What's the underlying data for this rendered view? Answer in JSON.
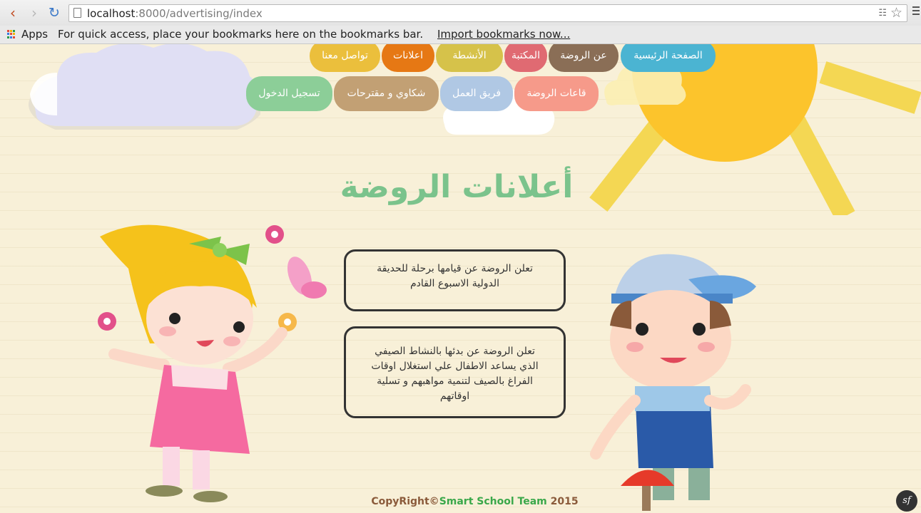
{
  "browser": {
    "url_host": "localhost",
    "url_path": ":8000/advertising/index",
    "apps_label": "Apps",
    "bookmarks_hint": "For quick access, place your bookmarks here on the bookmarks bar.",
    "import_link": "Import bookmarks now..."
  },
  "nav": {
    "row1": [
      {
        "label": "الصفحة الرئيسية",
        "color": "#4bb4d2"
      },
      {
        "label": "عن الروضة",
        "color": "#8a6e56"
      },
      {
        "label": "المكتبة",
        "color": "#e06a72"
      },
      {
        "label": "الأنشطة",
        "color": "#d6c24a"
      },
      {
        "label": "اعلانات",
        "color": "#e67814"
      },
      {
        "label": "تواصل معنا",
        "color": "#ebbf3c"
      }
    ],
    "row2": [
      {
        "label": "قاعات الروضة",
        "color": "#f69a8a"
      },
      {
        "label": "فريق العمل",
        "color": "#b0c8e4"
      },
      {
        "label": "شكاوي و مقترحات",
        "color": "#c2a074"
      },
      {
        "label": "تسجيل الدخول",
        "color": "#8cce98"
      }
    ]
  },
  "title": "أعلانات الروضة",
  "notices": [
    "تعلن الروضة عن قيامها برحلة للحديقة الدولية الاسبوع القادم",
    "تعلن الروضة عن بدئها بالنشاط الصيفي الذي يساعد الاطفال علي استغلال اوقات الفراغ بالصيف لتنمية مواهبهم و تسلية اوقاتهم"
  ],
  "footer": {
    "prefix": "CopyRight©",
    "team": "Smart School Team",
    "year": " 2015"
  },
  "debug_badge": "sf"
}
